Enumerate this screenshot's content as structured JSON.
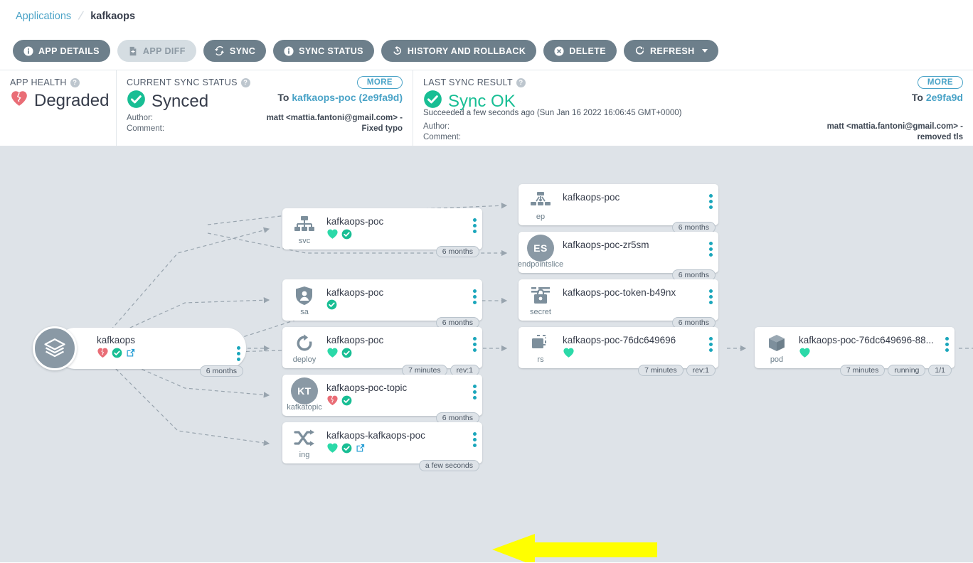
{
  "breadcrumb": {
    "root": "Applications",
    "current": "kafkaops"
  },
  "toolbar": {
    "buttons": [
      {
        "label": "APP DETAILS",
        "icon": "info-icon",
        "disabled": false
      },
      {
        "label": "APP DIFF",
        "icon": "file-diff-icon",
        "disabled": true
      },
      {
        "label": "SYNC",
        "icon": "sync-icon",
        "disabled": false
      },
      {
        "label": "SYNC STATUS",
        "icon": "info-icon",
        "disabled": false
      },
      {
        "label": "HISTORY AND ROLLBACK",
        "icon": "history-icon",
        "disabled": false
      },
      {
        "label": "DELETE",
        "icon": "delete-icon",
        "disabled": false
      },
      {
        "label": "REFRESH",
        "icon": "refresh-icon",
        "disabled": false,
        "caret": true
      }
    ]
  },
  "status": {
    "health": {
      "label": "APP HEALTH",
      "value": "Degraded",
      "icon": "broken-heart-icon"
    },
    "current_sync": {
      "label": "CURRENT SYNC STATUS",
      "value": "Synced",
      "icon": "check-circle-icon",
      "more": "MORE",
      "target_prefix": "To",
      "target_link": "kafkaops-poc (2e9fa9d)",
      "author_key": "Author:",
      "author_value": "matt <mattia.fantoni@gmail.com> -",
      "comment_key": "Comment:",
      "comment_value": "Fixed typo"
    },
    "last_sync": {
      "label": "LAST SYNC RESULT",
      "value": "Sync OK",
      "icon": "check-circle-icon",
      "more": "MORE",
      "target_prefix": "To",
      "target_link": "2e9fa9d",
      "succeeded": "Succeeded a few seconds ago (Sun Jan 16 2022 16:06:45 GMT+0000)",
      "author_key": "Author:",
      "author_value": "matt <mattia.fantoni@gmail.com> -",
      "comment_key": "Comment:",
      "comment_value": "removed tls"
    }
  },
  "colors": {
    "accent_teal": "#1aa6bb",
    "healthy_green": "#18be94",
    "degraded_red": "#e96d76",
    "link_blue": "#4aa3c7",
    "toolbar_gray": "#6d7f8b",
    "canvas_bg": "#dee3e8",
    "arrow_yellow": "#ffff00"
  },
  "nodes": {
    "app": {
      "title": "kafkaops",
      "kind": "app",
      "icon": "layers-icon",
      "health": "degraded",
      "synced": true,
      "external_link": true,
      "pills": [
        "6 months"
      ]
    },
    "col1": [
      {
        "title": "kafkaops-poc",
        "kind": "svc",
        "icon": "service-icon",
        "health": "healthy",
        "synced": true,
        "external_link": false,
        "pills": [
          "6 months"
        ]
      },
      {
        "title": "kafkaops-poc",
        "kind": "sa",
        "icon": "serviceaccount-icon",
        "health": "none",
        "synced": true,
        "external_link": false,
        "pills": [
          "6 months"
        ]
      },
      {
        "title": "kafkaops-poc",
        "kind": "deploy",
        "icon": "deployment-icon",
        "health": "healthy",
        "synced": true,
        "external_link": false,
        "pills": [
          "7 minutes",
          "rev:1"
        ]
      },
      {
        "title": "kafkaops-poc-topic",
        "kind": "kafkatopic",
        "icon": "kt-initials-icon",
        "initials": "KT",
        "health": "degraded",
        "synced": true,
        "external_link": false,
        "pills": [
          "6 months"
        ]
      },
      {
        "title": "kafkaops-kafkaops-poc",
        "kind": "ing",
        "icon": "ingress-icon",
        "health": "healthy",
        "synced": true,
        "external_link": true,
        "pills": [
          "a few seconds"
        ]
      }
    ],
    "col2": [
      {
        "title": "kafkaops-poc",
        "kind": "ep",
        "icon": "endpoints-icon",
        "health": "none",
        "synced": false,
        "external_link": false,
        "pills": [
          "6 months"
        ]
      },
      {
        "title": "kafkaops-poc-zr5sm",
        "kind": "endpointslice",
        "icon": "es-initials-icon",
        "initials": "ES",
        "health": "none",
        "synced": false,
        "external_link": false,
        "pills": [
          "6 months"
        ]
      },
      {
        "title": "kafkaops-poc-token-b49nx",
        "kind": "secret",
        "icon": "secret-icon",
        "health": "none",
        "synced": false,
        "external_link": false,
        "pills": [
          "6 months"
        ]
      },
      {
        "title": "kafkaops-poc-76dc649696",
        "kind": "rs",
        "icon": "replicaset-icon",
        "health": "healthy",
        "synced": false,
        "external_link": false,
        "pills": [
          "7 minutes",
          "rev:1"
        ]
      }
    ],
    "col3": [
      {
        "title": "kafkaops-poc-76dc649696-88...",
        "kind": "pod",
        "icon": "pod-icon",
        "health": "healthy",
        "synced": false,
        "external_link": false,
        "pills": [
          "7 minutes",
          "running",
          "1/1"
        ]
      }
    ]
  },
  "annotation": {
    "type": "arrow-left",
    "color": "#ffff00",
    "points_to": "kafkatopic-node"
  }
}
